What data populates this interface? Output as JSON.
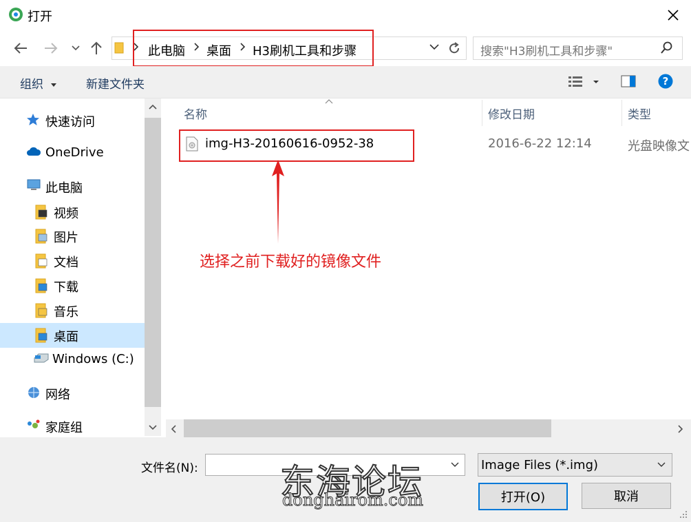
{
  "window": {
    "title": "打开"
  },
  "breadcrumb": [
    "此电脑",
    "桌面",
    "H3刷机工具和步骤"
  ],
  "search": {
    "placeholder": "搜索\"H3刷机工具和步骤\""
  },
  "toolbar": {
    "organize_label": "组织",
    "new_folder_label": "新建文件夹"
  },
  "sidebar": {
    "items": [
      {
        "label": "快速访问",
        "icon": "star-icon"
      },
      {
        "label": "OneDrive",
        "icon": "cloud-icon"
      },
      {
        "label": "此电脑",
        "icon": "computer-icon"
      },
      {
        "label": "视频",
        "icon": "video-folder-icon"
      },
      {
        "label": "图片",
        "icon": "pictures-folder-icon"
      },
      {
        "label": "文档",
        "icon": "documents-folder-icon"
      },
      {
        "label": "下载",
        "icon": "downloads-folder-icon"
      },
      {
        "label": "音乐",
        "icon": "music-folder-icon"
      },
      {
        "label": "桌面",
        "icon": "desktop-folder-icon"
      },
      {
        "label": "Windows (C:)",
        "icon": "drive-icon"
      },
      {
        "label": "网络",
        "icon": "network-icon"
      },
      {
        "label": "家庭组",
        "icon": "homegroup-icon"
      }
    ]
  },
  "columns": {
    "name": "名称",
    "modified": "修改日期",
    "type": "类型"
  },
  "files": [
    {
      "name": "img-H3-20160616-0952-38",
      "modified": "2016-6-22 12:14",
      "type": "光盘映像文"
    }
  ],
  "annotation": {
    "text": "选择之前下载好的镜像文件",
    "color": "#e02020"
  },
  "bottom": {
    "filename_label": "文件名(N):",
    "filename_value": "",
    "filter_value": "Image Files (*.img)",
    "open_label": "打开(O)",
    "cancel_label": "取消"
  },
  "watermark": {
    "cn": "东海论坛",
    "en": "donghairom.com"
  },
  "colors": {
    "accent": "#0078d7",
    "selection": "#cce8ff",
    "annotation": "#e02020"
  }
}
